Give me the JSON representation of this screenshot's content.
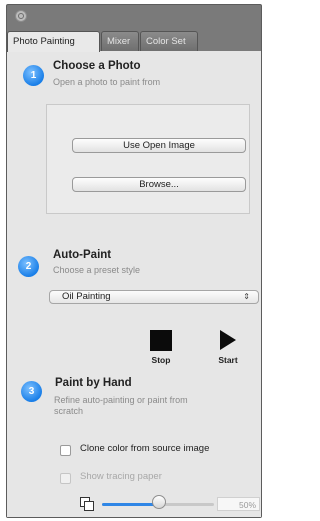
{
  "tabs": [
    {
      "label": "Photo Painting",
      "active": true
    },
    {
      "label": "Mixer",
      "active": false
    },
    {
      "label": "Color Set",
      "active": false
    }
  ],
  "step1": {
    "number": "1",
    "title": "Choose a Photo",
    "subtitle": "Open a photo to paint from",
    "use_open_image_label": "Use Open Image",
    "browse_label": "Browse..."
  },
  "step2": {
    "number": "2",
    "title": "Auto-Paint",
    "subtitle": "Choose a preset style",
    "preset_value": "Oil Painting",
    "stop_label": "Stop",
    "start_label": "Start"
  },
  "step3": {
    "number": "3",
    "title": "Paint by Hand",
    "subtitle_line1": "Refine auto-painting or paint from",
    "subtitle_line2": "scratch",
    "clone_color_label": "Clone color from source image",
    "show_tracing_label": "Show tracing paper",
    "tracing_opacity_percent": 50,
    "tracing_opacity_text": "50%"
  },
  "colors": {
    "step_badge": "#1a7fe8",
    "slider_fill": "#2f86e6"
  },
  "icons": {
    "stop": "stop-icon",
    "start": "play-icon",
    "tracing": "layers-icon",
    "dropdown": "chevron-updown-icon"
  }
}
